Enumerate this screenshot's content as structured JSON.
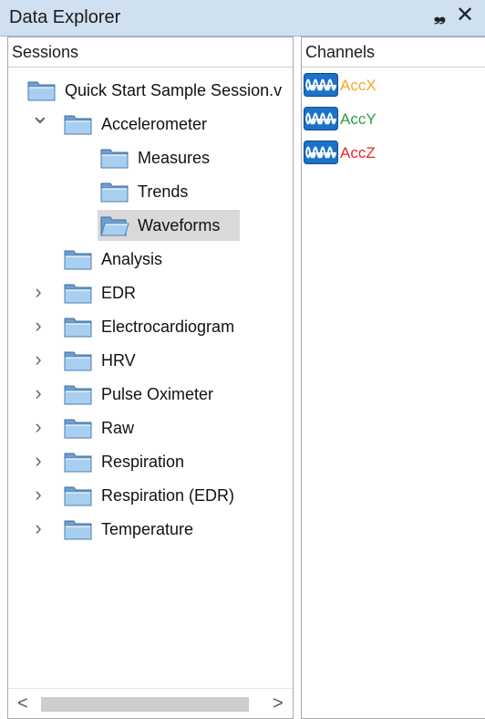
{
  "window": {
    "title": "Data Explorer",
    "pin_glyph": "❠",
    "close_glyph": "✕"
  },
  "sessions_pane": {
    "header": "Sessions",
    "tree": [
      {
        "label": "Quick Start Sample Session.v",
        "level": 0,
        "expander": "none",
        "icon": "folder-icon"
      },
      {
        "label": "Accelerometer",
        "level": 1,
        "expander": "expanded",
        "icon": "folder-icon"
      },
      {
        "label": "Measures",
        "level": 2,
        "expander": "none",
        "icon": "folder-icon"
      },
      {
        "label": "Trends",
        "level": 2,
        "expander": "none",
        "icon": "folder-icon"
      },
      {
        "label": "Waveforms",
        "level": 2,
        "expander": "none",
        "icon": "folder-open-icon",
        "selected": true
      },
      {
        "label": "Analysis",
        "level": 1,
        "expander": "none",
        "icon": "folder-icon"
      },
      {
        "label": "EDR",
        "level": 1,
        "expander": "collapsed",
        "icon": "folder-icon"
      },
      {
        "label": "Electrocardiogram",
        "level": 1,
        "expander": "collapsed",
        "icon": "folder-icon"
      },
      {
        "label": "HRV",
        "level": 1,
        "expander": "collapsed",
        "icon": "folder-icon"
      },
      {
        "label": "Pulse Oximeter",
        "level": 1,
        "expander": "collapsed",
        "icon": "folder-icon"
      },
      {
        "label": "Raw",
        "level": 1,
        "expander": "collapsed",
        "icon": "folder-icon"
      },
      {
        "label": "Respiration",
        "level": 1,
        "expander": "collapsed",
        "icon": "folder-icon"
      },
      {
        "label": "Respiration (EDR)",
        "level": 1,
        "expander": "collapsed",
        "icon": "folder-icon"
      },
      {
        "label": "Temperature",
        "level": 1,
        "expander": "collapsed",
        "icon": "folder-icon"
      }
    ],
    "scrollbar": {
      "left_arrow": "<",
      "right_arrow": ">"
    }
  },
  "channels_pane": {
    "header": "Channels",
    "channels": [
      {
        "label": "AccX",
        "color": "#f5a623",
        "icon": "waveform-icon"
      },
      {
        "label": "AccY",
        "color": "#2e9e3f",
        "icon": "waveform-icon"
      },
      {
        "label": "AccZ",
        "color": "#e8262b",
        "icon": "waveform-icon"
      }
    ]
  },
  "colors": {
    "title_bar": "#cfe0f1",
    "selection": "#d9d9d9",
    "folder_fill": "#a9cff0",
    "waveform_bg": "#1a72c9"
  }
}
